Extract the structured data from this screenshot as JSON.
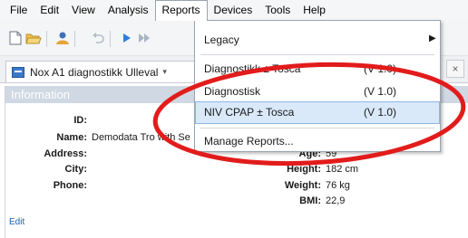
{
  "menubar": {
    "items": [
      "File",
      "Edit",
      "View",
      "Analysis",
      "Reports",
      "Devices",
      "Tools",
      "Help"
    ]
  },
  "toolbar": {
    "icons": [
      "new-document-icon",
      "open-folder-icon",
      "user-icon",
      "undo-icon",
      "play-icon",
      "fast-forward-icon"
    ]
  },
  "document_tab": {
    "label": "Nox A1 diagnostikk Ulleval",
    "close_label": "×"
  },
  "info_panel": {
    "title": "Information",
    "fields": {
      "id_label": "ID:",
      "name_label": "Name:",
      "name_value": "Demodata Tro with Se",
      "address_label": "Address:",
      "city_label": "City:",
      "phone_label": "Phone:",
      "age_label": "Age:",
      "age_value": "59",
      "height_label": "Height:",
      "height_value": "182 cm",
      "weight_label": "Weight:",
      "weight_value": "76 kg",
      "bmi_label": "BMI:",
      "bmi_value": "22,9"
    },
    "edit_link": "Edit"
  },
  "reports_menu": {
    "legacy": "Legacy",
    "item1_label": "Diagnostikk ± Tosca",
    "item1_version": "(V 1.0)",
    "item2_label": "Diagnostisk",
    "item2_version": "(V 1.0)",
    "item3_label": "NIV CPAP ± Tosca",
    "item3_version": "(V 1.0)",
    "manage": "Manage Reports..."
  },
  "colors": {
    "annotation": "#e21b1b",
    "highlight": "#d9e9fa",
    "panel_header": "#cfd8e3",
    "link": "#1b5fb5"
  }
}
